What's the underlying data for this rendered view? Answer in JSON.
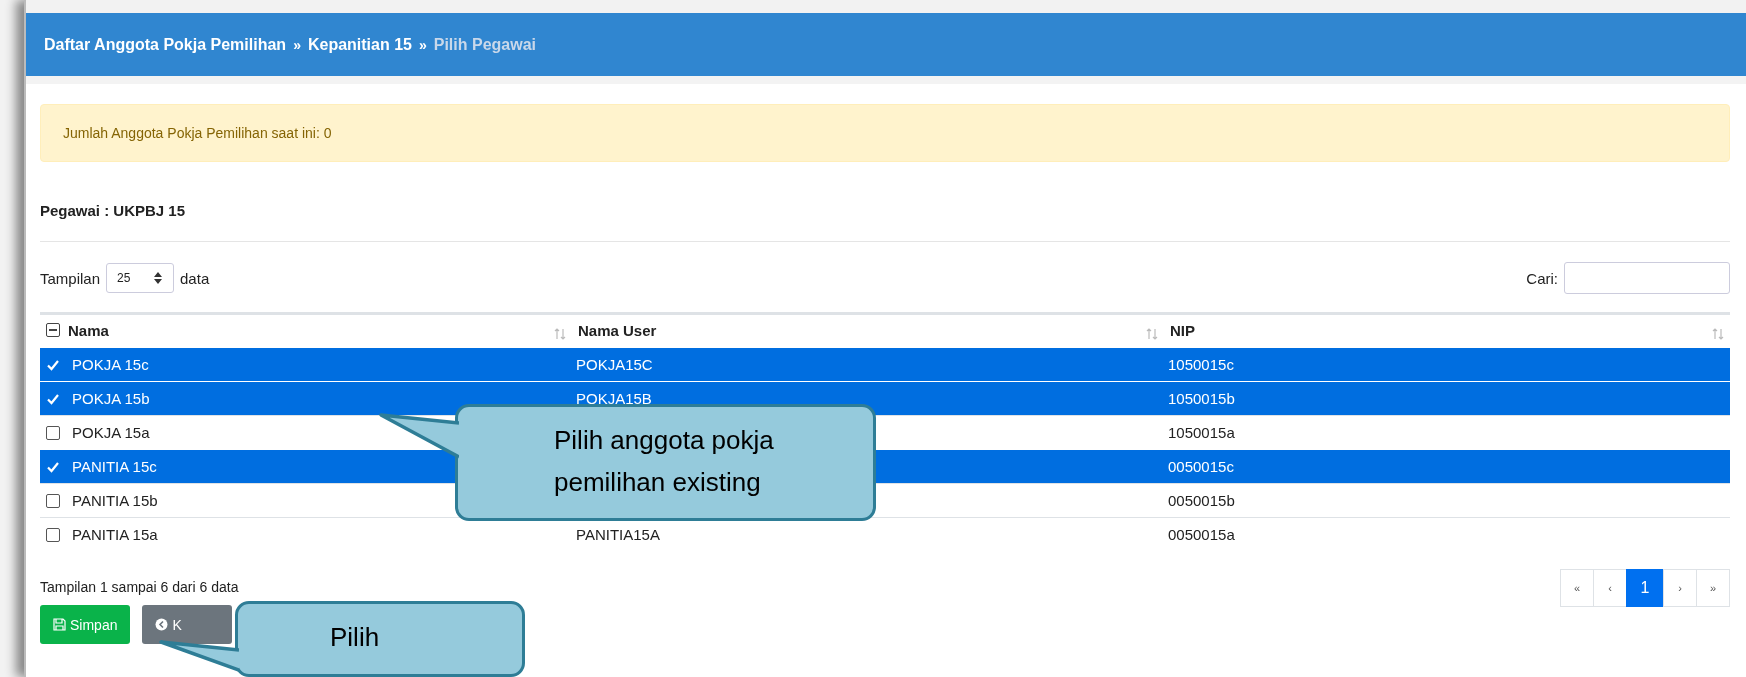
{
  "breadcrumb": [
    {
      "label": "Daftar Anggota Pokja Pemilihan",
      "current": false
    },
    {
      "label": "Kepanitian 15",
      "current": false
    },
    {
      "label": "Pilih Pegawai",
      "current": true
    }
  ],
  "breadcrumb_separator": "»",
  "alert": "Jumlah Anggota Pokja Pemilihan saat ini: 0",
  "section_title": "Pegawai : UKPBJ 15",
  "length_control": {
    "prefix": "Tampilan",
    "value": "25",
    "suffix": "data"
  },
  "search": {
    "label": "Cari:"
  },
  "table": {
    "select_all": {
      "indeterminate": true
    },
    "columns": [
      "Nama",
      "Nama User",
      "NIP"
    ],
    "rows": [
      {
        "name": "POKJA 15c",
        "user": "POKJA15C",
        "nip": "1050015c",
        "selected": true
      },
      {
        "name": "POKJA 15b",
        "user": "POKJA15B",
        "nip": "1050015b",
        "selected": true
      },
      {
        "name": "POKJA 15a",
        "nip": "1050015a",
        "selected": false
      },
      {
        "name": "PANITIA 15c",
        "nip": "0050015c",
        "selected": true
      },
      {
        "name": "PANITIA 15b",
        "nip": "0050015b",
        "selected": false
      },
      {
        "name": "PANITIA 15a",
        "user": "PANITIA15A",
        "nip": "0050015a",
        "selected": false
      }
    ]
  },
  "info": "Tampilan 1 sampai 6 dari 6 data",
  "pagination": [
    {
      "label": "«",
      "selected": false
    },
    {
      "label": "‹",
      "selected": false
    },
    {
      "label": "1",
      "selected": true
    },
    {
      "label": "›",
      "selected": false
    },
    {
      "label": "»",
      "selected": false
    }
  ],
  "buttons": [
    {
      "kind": "save",
      "label": "Simpan"
    },
    {
      "kind": "back",
      "label": "K"
    }
  ],
  "callouts": [
    {
      "text": "Pilih anggota pokja pemilihan existing"
    },
    {
      "text": "Pilih"
    }
  ]
}
